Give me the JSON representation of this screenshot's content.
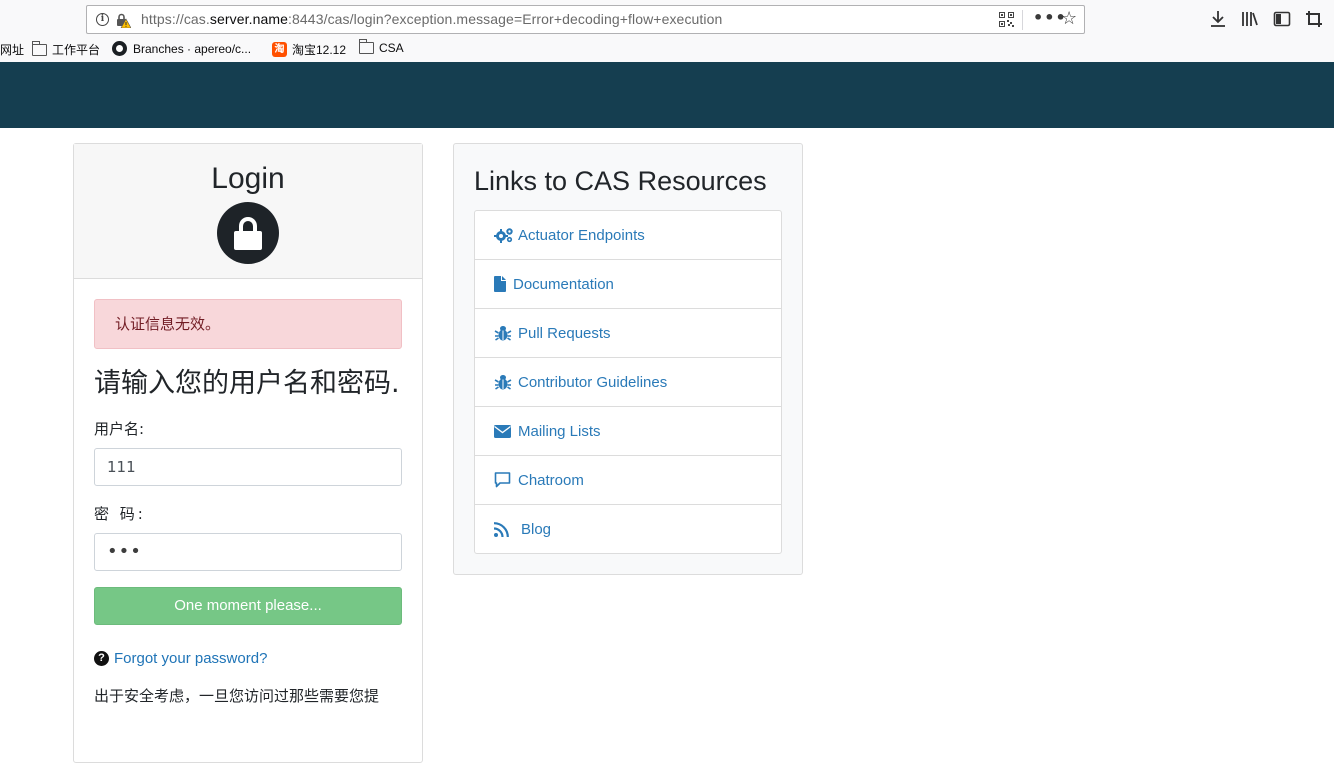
{
  "browser": {
    "url_prefix": "https://cas.",
    "url_host": "server.name",
    "url_suffix": ":8443/cas/login?exception.message=Error+decoding+flow+execution",
    "more_label": "•••",
    "star_label": "☆",
    "bookmarks": [
      {
        "label": "网址",
        "icon": "none"
      },
      {
        "label": "工作平台",
        "icon": "folder-icon"
      },
      {
        "label": "Branches · apereo/c...",
        "icon": "github-icon"
      },
      {
        "label": "淘宝12.12",
        "icon": "taobao-icon"
      },
      {
        "label": "CSA",
        "icon": "folder-icon"
      }
    ],
    "taobao_glyph": "淘"
  },
  "login": {
    "title": "Login",
    "error_message": "认证信息无效。",
    "prompt": "请输入您的用户名和密码.",
    "username_label": "用户名:",
    "username_value": "111",
    "password_label": "密 码:",
    "password_value": "•••",
    "submit_label": "One moment please...",
    "forgot_icon": "?",
    "forgot_label": "Forgot your password?",
    "security_note": "出于安全考虑，一旦您访问过那些需要您提"
  },
  "resources": {
    "title": "Links to CAS Resources",
    "links": [
      {
        "label": "Actuator Endpoints",
        "icon": "gears-icon"
      },
      {
        "label": "Documentation",
        "icon": "file-icon"
      },
      {
        "label": "Pull Requests",
        "icon": "bug-icon"
      },
      {
        "label": "Contributor Guidelines",
        "icon": "bug-icon"
      },
      {
        "label": "Mailing Lists",
        "icon": "envelope-icon"
      },
      {
        "label": "Chatroom",
        "icon": "comment-icon"
      },
      {
        "label": "Blog",
        "icon": "rss-icon"
      }
    ]
  },
  "colors": {
    "header": "#153e50",
    "link": "#2a7ab8",
    "submit": "#76c786",
    "alert_bg": "#f8d7da",
    "alert_text": "#721c24"
  }
}
